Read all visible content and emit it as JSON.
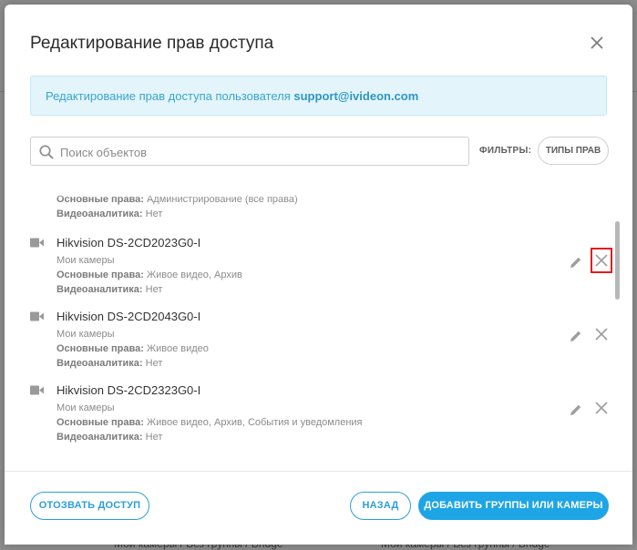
{
  "background": {
    "row_texts": [
      "Мои камеры / Без группы / Bridge",
      "Мои камеры / Без группы / Bridge"
    ]
  },
  "dialog": {
    "title": "Редактирование прав доступа",
    "info_prefix": "Редактирование прав доступа пользователя ",
    "info_user": "support@ivideon.com",
    "search_placeholder": "Поиск объектов",
    "filters_label": "ФИЛЬТРЫ:",
    "filter_chip": "ТИПЫ ПРАВ",
    "partial_item": {
      "rights_label": "Основные права:",
      "rights_value": " Администрирование (все права)",
      "analytics_label": "Видеоаналитика:",
      "analytics_value": " Нет"
    },
    "items": [
      {
        "name": "Hikvision DS-2CD2023G0-I",
        "group": "Мои камеры",
        "rights_label": "Основные права:",
        "rights_value": " Живое видео, Архив",
        "analytics_label": "Видеоаналитика:",
        "analytics_value": " Нет"
      },
      {
        "name": "Hikvision DS-2CD2043G0-I",
        "group": "Мои камеры",
        "rights_label": "Основные права:",
        "rights_value": " Живое видео",
        "analytics_label": "Видеоаналитика:",
        "analytics_value": " Нет"
      },
      {
        "name": "Hikvision DS-2CD2323G0-I",
        "group": "Мои камеры",
        "rights_label": "Основные права:",
        "rights_value": " Живое видео, Архив, События и уведомления",
        "analytics_label": "Видеоаналитика:",
        "analytics_value": " Нет"
      }
    ],
    "footer": {
      "revoke": "ОТОЗВАТЬ ДОСТУП",
      "back": "НАЗАД",
      "add": "ДОБАВИТЬ ГРУППЫ ИЛИ КАМЕРЫ"
    }
  },
  "colors": {
    "accent": "#1ea5e6",
    "info_bg": "#e3f5fb",
    "highlight": "#e21d1d"
  },
  "icons": {
    "close": "close-icon",
    "search": "search-icon",
    "camera": "camera-icon",
    "edit": "pencil-icon",
    "delete": "delete-x-icon"
  }
}
